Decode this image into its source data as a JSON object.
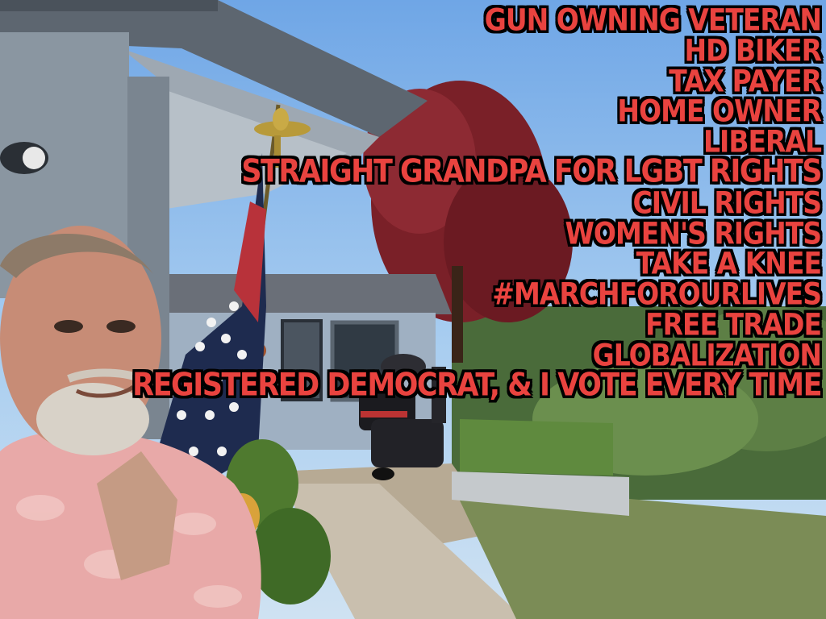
{
  "overlay": {
    "color": "#e9433f",
    "outline_color": "#000000",
    "lines": [
      "GUN OWNING VETERAN",
      "HD BIKER",
      "TAX PAYER",
      "HOME OWNER",
      "LIBERAL",
      "STRAIGHT GRANDPA FOR LGBT RIGHTS",
      "CIVIL RIGHTS",
      "WOMEN'S RIGHTS",
      "TAKE A KNEE",
      "#MARCHFOROURLIVES",
      "FREE TRADE",
      "GLOBALIZATION",
      "REGISTERED DEMOCRAT, & I VOTE EVERY TIME"
    ]
  },
  "photo": {
    "subjects": [
      "man-selfie",
      "house-porch",
      "american-flag",
      "brass-eagle-finial",
      "motorcycle",
      "red-leaf-tree",
      "garden-walkway",
      "raised-planter-bed"
    ]
  }
}
